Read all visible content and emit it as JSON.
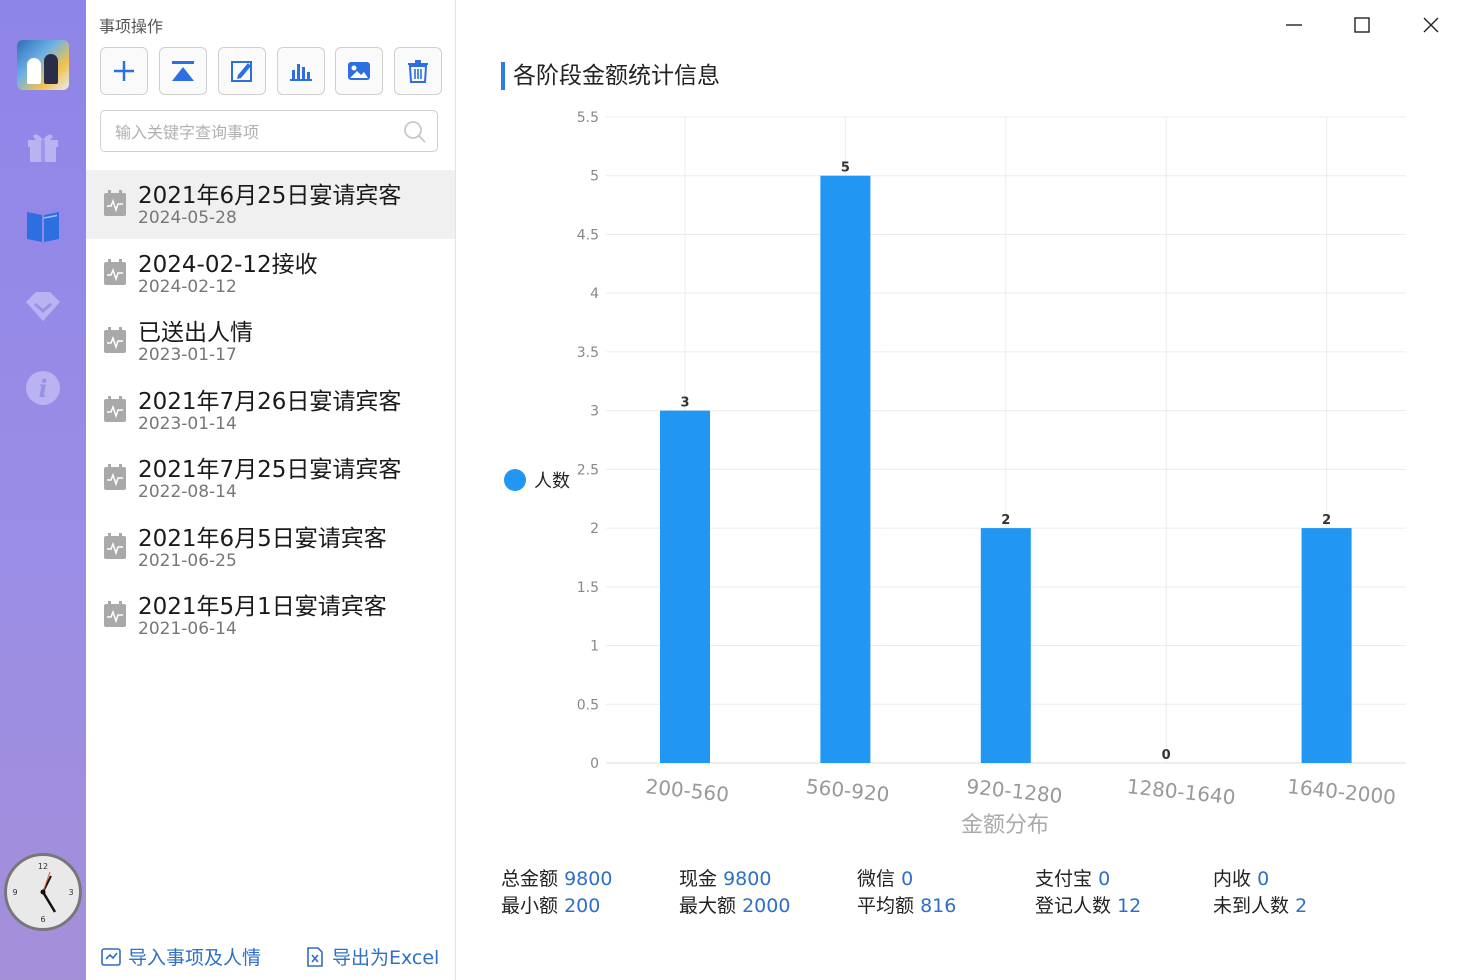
{
  "panel": {
    "title": "事项操作",
    "search_placeholder": "输入关键字查询事项",
    "items": [
      {
        "name": "2021年6月25日宴请宾客",
        "date": "2024-05-28"
      },
      {
        "name": "2024-02-12接收",
        "date": "2024-02-12"
      },
      {
        "name": "已送出人情",
        "date": "2023-01-17"
      },
      {
        "name": "2021年7月26日宴请宾客",
        "date": "2023-01-14"
      },
      {
        "name": "2021年7月25日宴请宾客",
        "date": "2022-08-14"
      },
      {
        "name": "2021年6月5日宴请宾客",
        "date": "2021-06-25"
      },
      {
        "name": "2021年5月1日宴请宾客",
        "date": "2021-06-14"
      }
    ],
    "import_label": "导入事项及人情",
    "export_label": "导出为Excel"
  },
  "main": {
    "title": "各阶段金额统计信息",
    "legend_label": "人数",
    "stats": [
      {
        "label": "总金额",
        "value": "9800"
      },
      {
        "label": "现金",
        "value": "9800"
      },
      {
        "label": "微信",
        "value": "0"
      },
      {
        "label": "支付宝",
        "value": "0"
      },
      {
        "label": "内收",
        "value": "0"
      },
      {
        "label": "最小额",
        "value": "200"
      },
      {
        "label": "最大额",
        "value": "2000"
      },
      {
        "label": "平均额",
        "value": "816"
      },
      {
        "label": "登记人数",
        "value": "12"
      },
      {
        "label": "未到人数",
        "value": "2"
      }
    ]
  },
  "chart_data": {
    "type": "bar",
    "categories": [
      "200-560",
      "560-920",
      "920-1280",
      "1280-1640",
      "1640-2000"
    ],
    "series": [
      {
        "name": "人数",
        "values": [
          3,
          5,
          2,
          0,
          2
        ]
      }
    ],
    "xlabel": "金额分布",
    "ylabel": "",
    "ylim": [
      0,
      5.5
    ],
    "yticks": [
      "0",
      "0.5",
      "1",
      "1.5",
      "2",
      "2.5",
      "3",
      "3.5",
      "4",
      "4.5",
      "5",
      "5.5"
    ],
    "legend": "left",
    "grid": true,
    "bar_color": "#2196f3"
  },
  "colors": {
    "accent": "#2e6fc7",
    "rail": "#8e85e8"
  }
}
